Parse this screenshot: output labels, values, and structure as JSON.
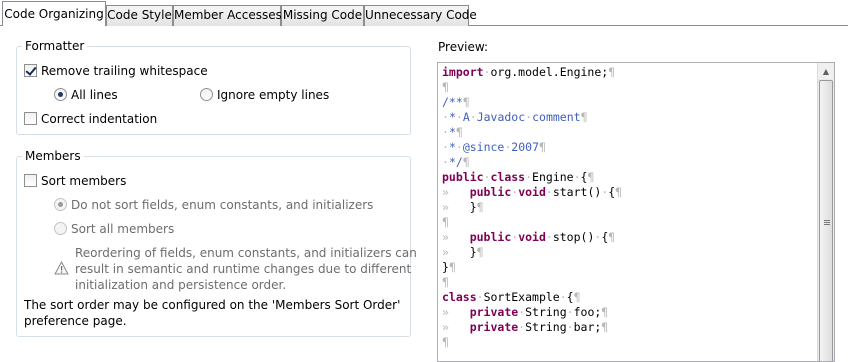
{
  "tabs": [
    {
      "label": "Code Organizing",
      "active": true
    },
    {
      "label": "Code Style",
      "active": false
    },
    {
      "label": "Member Accesses",
      "active": false
    },
    {
      "label": "Missing Code",
      "active": false
    },
    {
      "label": "Unnecessary Code",
      "active": false
    }
  ],
  "formatter": {
    "legend": "Formatter",
    "remove_trailing": {
      "label": "Remove trailing whitespace",
      "checked": true
    },
    "all_lines": {
      "label": "All lines",
      "selected": true
    },
    "ignore_empty": {
      "label": "Ignore empty lines",
      "selected": false
    },
    "correct_indentation": {
      "label": "Correct indentation",
      "checked": false
    }
  },
  "members": {
    "legend": "Members",
    "sort_members": {
      "label": "Sort members",
      "checked": false
    },
    "do_not_sort": {
      "label": "Do not sort fields, enum constants, and initializers",
      "selected": true
    },
    "sort_all": {
      "label": "Sort all members",
      "selected": false
    },
    "warning_lines": [
      "Reordering of fields, enum constants, and initializers can",
      "result in semantic and runtime changes due to different",
      "initialization and persistence order."
    ],
    "note_lines": [
      "The sort order may be configured on the 'Members Sort Order'",
      "preference page."
    ]
  },
  "preview": {
    "label": "Preview:",
    "lines": [
      "import org.model.Engine;",
      "",
      "/**",
      " * A Javadoc comment",
      " *",
      " * @since 2007",
      " */",
      "public class Engine {",
      "\tpublic void start() {",
      "\t}",
      "",
      "\tpublic void stop() {",
      "\t}",
      "}",
      "",
      "class SortExample {",
      "\tprivate String foo;",
      "\tprivate String bar;",
      ""
    ]
  },
  "icons": {
    "warning": "warning-icon",
    "scroll_up": "scroll-up-arrow-icon",
    "scroll_grip": "scrollbar-grip-icon"
  },
  "colors": {
    "keyword": "#7f0055",
    "javadoc": "#3f5fbf",
    "whitespace_marker": "#b8b8b8",
    "group_border": "#d5dfe5"
  }
}
